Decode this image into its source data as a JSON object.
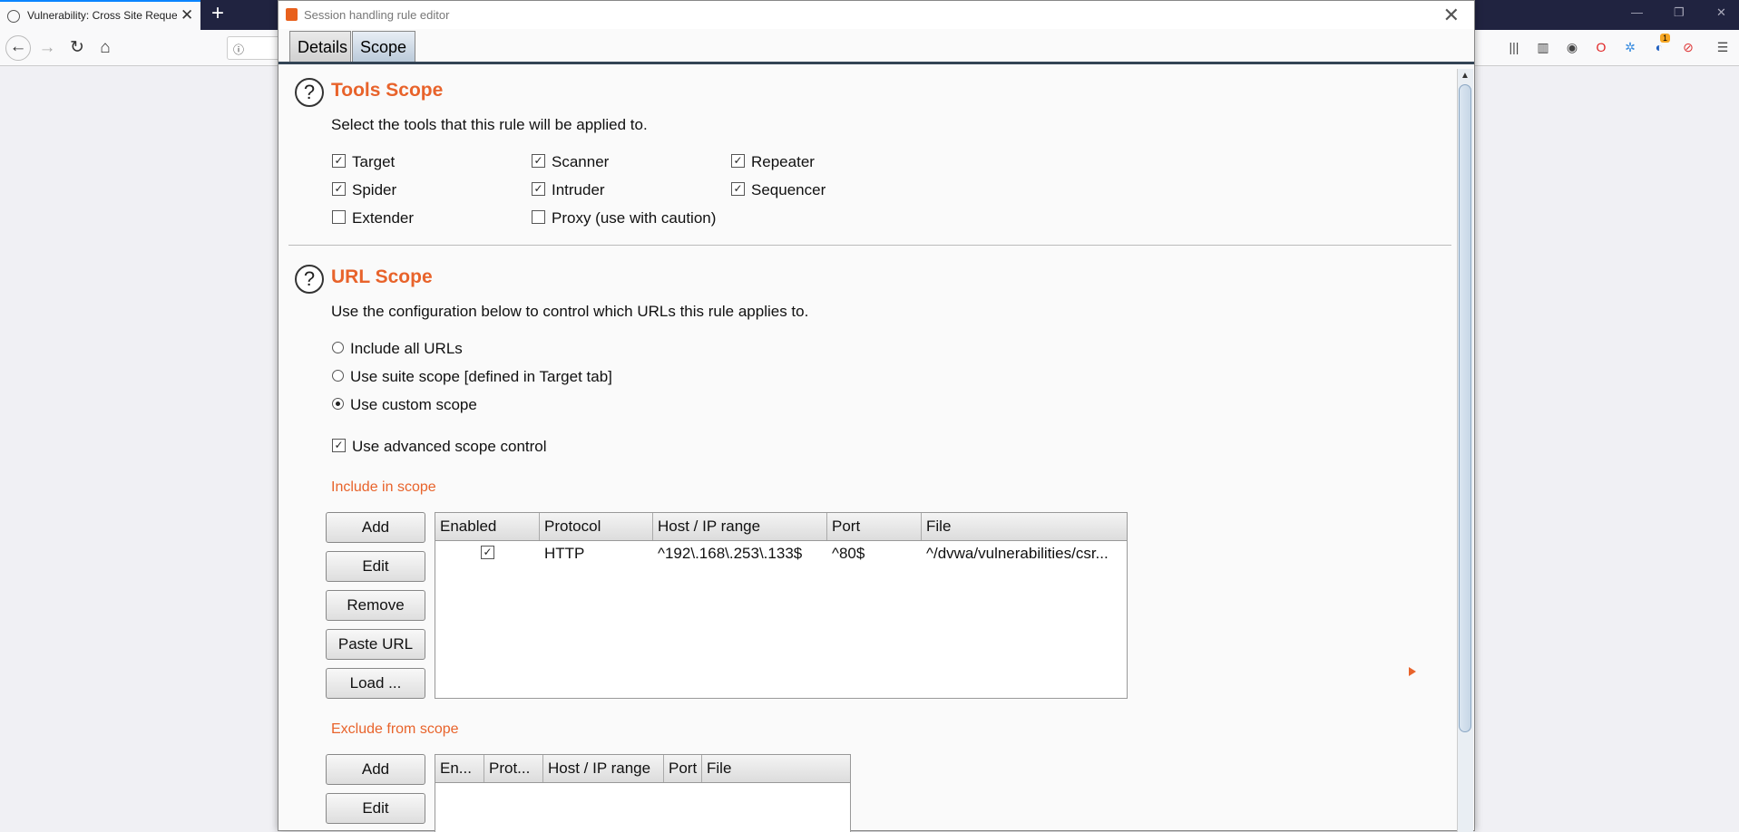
{
  "browser": {
    "tab_title": "Vulnerability: Cross Site Request Forgery",
    "new_tab": "+",
    "nav": {
      "back": "←",
      "forward": "→",
      "reload": "↻",
      "home": "⌂"
    },
    "urlbar_text": "ⓘ",
    "window_controls": [
      "—",
      "❐",
      "✕"
    ],
    "extension_badge": "1"
  },
  "dialog": {
    "title": "Session handling rule editor",
    "close": "✕",
    "tabs": [
      {
        "label": "Details"
      },
      {
        "label": "Scope"
      }
    ]
  },
  "tools_scope": {
    "help": "?",
    "title": "Tools Scope",
    "description": "Select the tools that this rule will be applied to.",
    "tools": [
      {
        "label": "Target",
        "checked": true
      },
      {
        "label": "Scanner",
        "checked": true
      },
      {
        "label": "Repeater",
        "checked": true
      },
      {
        "label": "Spider",
        "checked": true
      },
      {
        "label": "Intruder",
        "checked": true
      },
      {
        "label": "Sequencer",
        "checked": true
      },
      {
        "label": "Extender",
        "checked": false
      },
      {
        "label": "Proxy (use with caution)",
        "checked": false
      }
    ]
  },
  "url_scope": {
    "help": "?",
    "title": "URL Scope",
    "description": "Use the configuration below to control which URLs this rule applies to.",
    "options": [
      {
        "label": "Include all URLs",
        "selected": false
      },
      {
        "label": "Use suite scope [defined in Target tab]",
        "selected": false
      },
      {
        "label": "Use custom scope",
        "selected": true
      }
    ],
    "advanced": {
      "label": "Use advanced scope control",
      "checked": true
    },
    "include": {
      "label": "Include in scope",
      "buttons": [
        "Add",
        "Edit",
        "Remove",
        "Paste URL",
        "Load ..."
      ],
      "columns": [
        "Enabled",
        "Protocol",
        "Host / IP range",
        "Port",
        "File"
      ],
      "rows": [
        {
          "enabled": true,
          "protocol": "HTTP",
          "host": "^192\\.168\\.253\\.133$",
          "port": "^80$",
          "file": "^/dvwa/vulnerabilities/csr..."
        }
      ]
    },
    "exclude": {
      "label": "Exclude from scope",
      "buttons": [
        "Add",
        "Edit"
      ],
      "columns": [
        "En...",
        "Prot...",
        "Host / IP range",
        "Port",
        "File"
      ]
    }
  },
  "colors": {
    "accent": "#e8632b",
    "tab_strip": "#202340"
  }
}
